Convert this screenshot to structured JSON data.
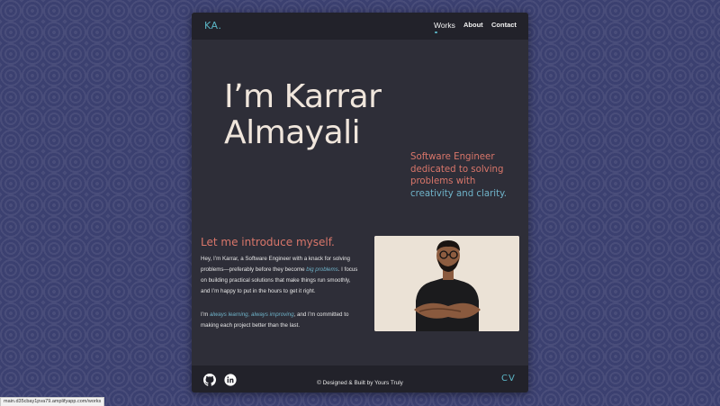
{
  "nav": {
    "logo": "KA.",
    "links": [
      "Works",
      "About",
      "Contact"
    ],
    "active": "Works"
  },
  "hero": {
    "title_line1": "I’m Karrar",
    "title_line2": "Almayali",
    "tagline_part1": "Software Engineer dedicated to solving problems with ",
    "tagline_highlight": "creativity and clarity",
    "tagline_end": "."
  },
  "intro": {
    "heading": "Let me introduce myself.",
    "p1_part1": "Hey, I’m Karrar, a Software Engineer with a knack for solving problems—preferably before they become ",
    "p1_em": "big problems",
    "p1_part2": ". I focus on building practical solutions that make things run smoothly, and I’m happy to put in the hours to get it right.",
    "p2_part1": "I’m ",
    "p2_em": "always learning, always improving",
    "p2_part2": ", and I’m committed to making each project better than the last."
  },
  "footer": {
    "copyright": "© Designed & Built by Yours Truly",
    "cv": "CV",
    "socials": [
      "github-icon",
      "linkedin-icon"
    ]
  },
  "status_url": "main.d35cbay1pva79.amplifyapp.com/works",
  "colors": {
    "accent_teal": "#5bb6c6",
    "accent_coral": "#d9766a",
    "card_bg": "#2e2e38",
    "bar_bg": "#22222a",
    "hero_text": "#f0e6dc"
  }
}
